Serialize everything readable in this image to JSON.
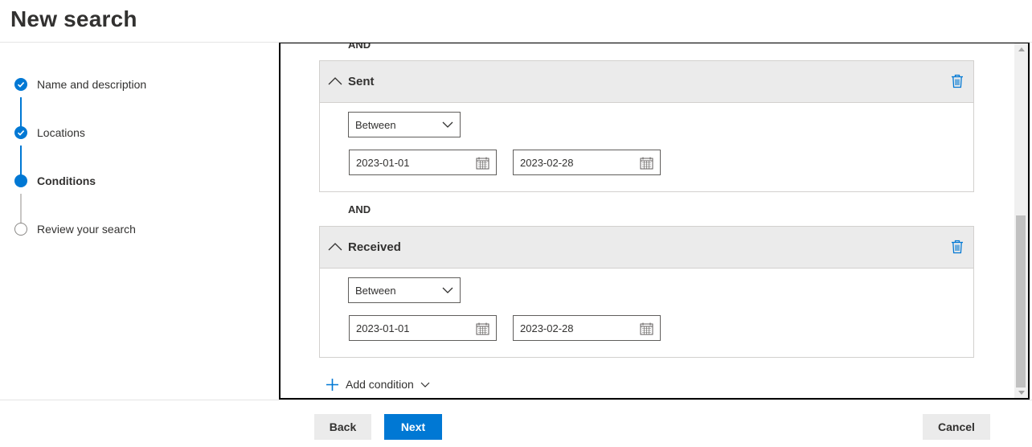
{
  "title": "New search",
  "steps": [
    {
      "label": "Name and description",
      "state": "done"
    },
    {
      "label": "Locations",
      "state": "done"
    },
    {
      "label": "Conditions",
      "state": "current"
    },
    {
      "label": "Review your search",
      "state": "todo"
    }
  ],
  "conditions": {
    "top_and": "AND",
    "middle_and": "AND",
    "sent": {
      "title": "Sent",
      "operator": "Between",
      "start_date": "2023-01-01",
      "end_date": "2023-02-28"
    },
    "received": {
      "title": "Received",
      "operator": "Between",
      "start_date": "2023-01-01",
      "end_date": "2023-02-28"
    },
    "add_condition_label": "Add condition"
  },
  "footer": {
    "back_label": "Back",
    "next_label": "Next",
    "cancel_label": "Cancel"
  },
  "colors": {
    "accent": "#0078d4",
    "header_bg": "#ebebeb"
  },
  "icons": [
    "check-icon",
    "chevron-up-icon",
    "delete-icon",
    "chevron-down-icon",
    "calendar-icon",
    "plus-icon"
  ]
}
